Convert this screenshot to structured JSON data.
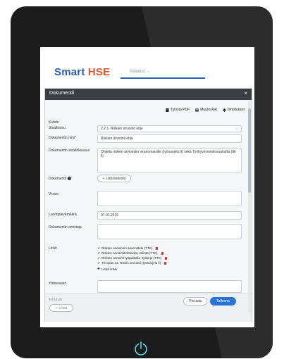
{
  "header": {
    "brand_smart": "Smart",
    "brand_hse": "HSE",
    "services_label": "Palvelut"
  },
  "dialog": {
    "title": "Dokumentti",
    "close": "×"
  },
  "actions": {
    "print_pdf": "Tulosta PDF",
    "changelog": "Muutosloki",
    "notifications": "Ilmoitukset"
  },
  "form": {
    "target_label": "Kohde",
    "section_label": "Sisältösivu",
    "section_value": "2.2.1. Riskien arviointi ohje",
    "name_label": "Dokumentin nimi*",
    "name_value": "Riskien arviointi ohje",
    "description_label": "Dokumentin sisältökuvaus",
    "description_value": "Ohjeita riskien arviointiin viranomaisille (työsuojelu ll) sekä Työhyvinvointiosuuksilla (ttk ll)",
    "document_label": "Dokumentti",
    "add_file": "Liitä tiedosto",
    "version_label": "Versio",
    "created_label": "Luontipäivämäärä",
    "created_value": "07.01.2019",
    "owner_label": "Dokumentin omistaja",
    "links_label": "Linkit",
    "links": [
      "Riskien arvioinnin suunnittelu (TTK)",
      "Riskien arviointikohteiden valinta (TTK)",
      "Riskien arviointi työpaikalla -työkirja (TTK)",
      "TS-opas 14. Riskin arviointi (työsuojelu ll)"
    ],
    "add_link": "Lisää linkki",
    "summary_label": "Yhteenveto"
  },
  "footer": {
    "tasks_label": "Tehtävät",
    "add_button": "Lisää",
    "cancel_button": "Peruuta",
    "save_button": "Tallenna"
  },
  "colors": {
    "brand_blue": "#2b5fb3",
    "brand_orange": "#e4572e",
    "dialog_header": "#3a3d42",
    "save_blue": "#2a74d6",
    "trash_red": "#dd3333"
  }
}
